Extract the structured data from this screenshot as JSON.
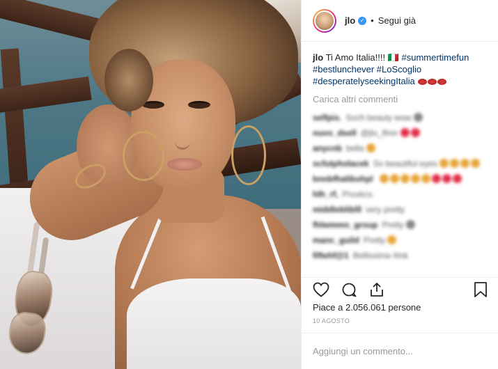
{
  "post": {
    "username": "jlo",
    "follow_label": "Segui già",
    "separator": "•",
    "caption": {
      "user": "jlo",
      "text": "Ti Amo Italia!!!! 🇮🇹",
      "tags": [
        "#summertimefun",
        "#bestlunchever",
        "#LoScoglio",
        "#desperatelyseekingItalia"
      ]
    },
    "load_more": "Carica altri commenti",
    "blurred_comments": [
      {
        "user": "selfpix.",
        "text": "Such beauty wow",
        "emojis": [
          "grey"
        ]
      },
      {
        "user": "nuvo_dsell",
        "text": "@jlo_lfmn",
        "emojis": [
          "red",
          "red"
        ]
      },
      {
        "user": "anycnb",
        "text": "bella",
        "emojis": [
          "orange"
        ]
      },
      {
        "user": "scfutpholacek",
        "text": "So beautiful eyes",
        "emojis": [
          "orange",
          "orange",
          "orange",
          "orange"
        ]
      },
      {
        "user": "bnnbfhalibohpl",
        "text": "",
        "emojis": [
          "orange",
          "orange",
          "orange",
          "orange",
          "orange",
          "red",
          "red",
          "red"
        ]
      },
      {
        "user": "hlh_rf,",
        "text": "Pruvkcs.",
        "emojis": []
      },
      {
        "user": "middlebliblll",
        "text": "very pretty",
        "emojis": []
      },
      {
        "user": "fhlwmmn_group",
        "text": "Pretty",
        "emojis": [
          "grey"
        ]
      },
      {
        "user": "manc_guild",
        "text": "Pretty",
        "emojis": [
          "orange"
        ]
      },
      {
        "user": "fiftehf@1",
        "text": "Bellissima #ink",
        "emojis": []
      }
    ],
    "likes_text": "Piace a 2.056.061 persone",
    "date": "10 AGOSTO",
    "comment_placeholder": "Aggiungi un commento..."
  },
  "colors": {
    "link": "#003569",
    "verified": "#3897f0",
    "muted": "#999999"
  },
  "icons": [
    "heart-icon",
    "comment-icon",
    "share-icon",
    "bookmark-icon",
    "verified-icon"
  ]
}
